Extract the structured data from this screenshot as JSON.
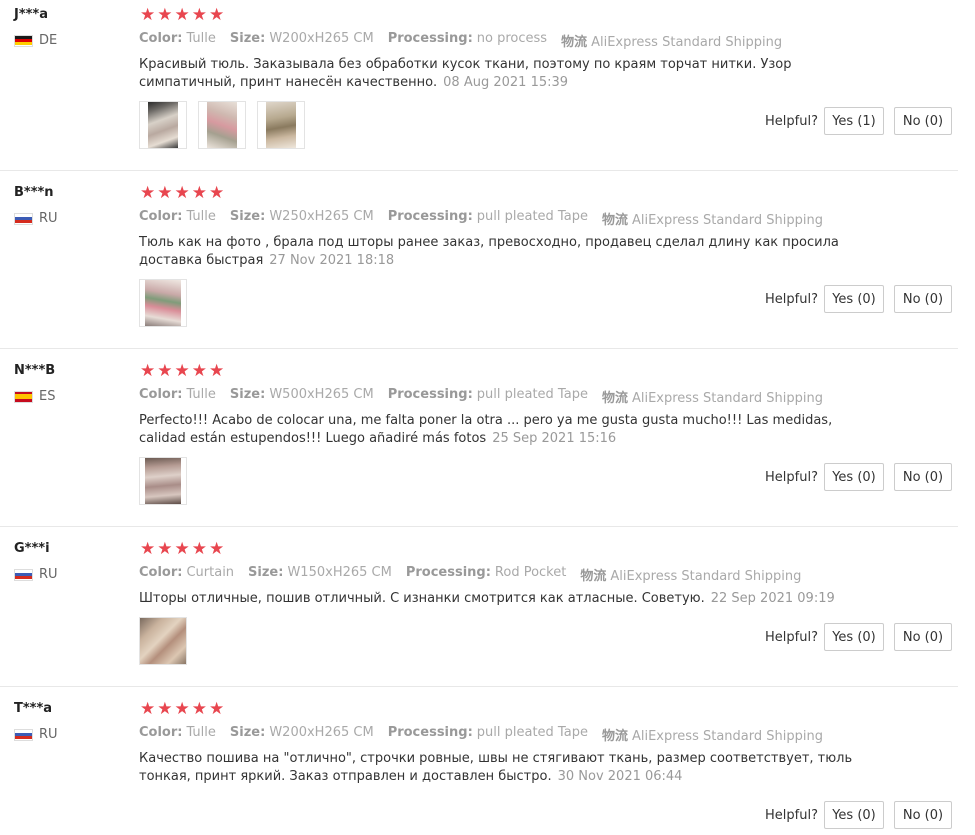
{
  "labels": {
    "color": "Color:",
    "size": "Size:",
    "processing": "Processing:",
    "logistics": "物流",
    "helpful": "Helpful?"
  },
  "colors": {
    "star": "#e8464f",
    "meta_key": "#999999"
  },
  "reviews": [
    {
      "user": "J***a",
      "country": "DE",
      "flag": "de",
      "stars": "★★★★★",
      "color": "Tulle",
      "size": "W200xH265 CM",
      "processing": "no process",
      "shipping": "AliExpress Standard Shipping",
      "text": "Красивый тюль. Заказывала без обработки кусок ткани, поэтому по краям торчат нитки. Узор симпатичный, принт нанесён качественно.",
      "date": "08 Aug 2021 15:39",
      "yes": "Yes (1)",
      "no": "No (0)",
      "images": 3
    },
    {
      "user": "B***n",
      "country": "RU",
      "flag": "ru",
      "stars": "★★★★★",
      "color": "Tulle",
      "size": "W250xH265 CM",
      "processing": "pull pleated Tape",
      "shipping": "AliExpress Standard Shipping",
      "text": "Тюль как на фото , брала под шторы ранее заказ, превосходно, продавец сделал длину как просила доставка быстрая",
      "date": "27 Nov 2021 18:18",
      "yes": "Yes (0)",
      "no": "No (0)",
      "images": 1
    },
    {
      "user": "N***B",
      "country": "ES",
      "flag": "es",
      "stars": "★★★★★",
      "color": "Tulle",
      "size": "W500xH265 CM",
      "processing": "pull pleated Tape",
      "shipping": "AliExpress Standard Shipping",
      "text": "Perfecto!!! Acabo de colocar una, me falta poner la otra ... pero ya me gusta gusta mucho!!! Las medidas, calidad están estupendos!!! Luego añadiré más fotos",
      "date": "25 Sep 2021 15:16",
      "yes": "Yes (0)",
      "no": "No (0)",
      "images": 1
    },
    {
      "user": "G***i",
      "country": "RU",
      "flag": "ru",
      "stars": "★★★★★",
      "color": "Curtain",
      "size": "W150xH265 CM",
      "processing": "Rod Pocket",
      "shipping": "AliExpress Standard Shipping",
      "text": "Шторы отличные, пошив отличный. С изнанки смотрится как атласные. Советую.",
      "date": "22 Sep 2021 09:19",
      "yes": "Yes (0)",
      "no": "No (0)",
      "images": 1
    },
    {
      "user": "T***a",
      "country": "RU",
      "flag": "ru",
      "stars": "★★★★★",
      "color": "Tulle",
      "size": "W200xH265 CM",
      "processing": "pull pleated Tape",
      "shipping": "AliExpress Standard Shipping",
      "text": "Качество пошива на \"отлично\", строчки ровные, швы не стягивают ткань, размер соответствует, тюль тонкая, принт яркий. Заказ отправлен и доставлен быстро.",
      "date": "30 Nov 2021 06:44",
      "yes": "Yes (0)",
      "no": "No (0)",
      "images": 0
    }
  ]
}
